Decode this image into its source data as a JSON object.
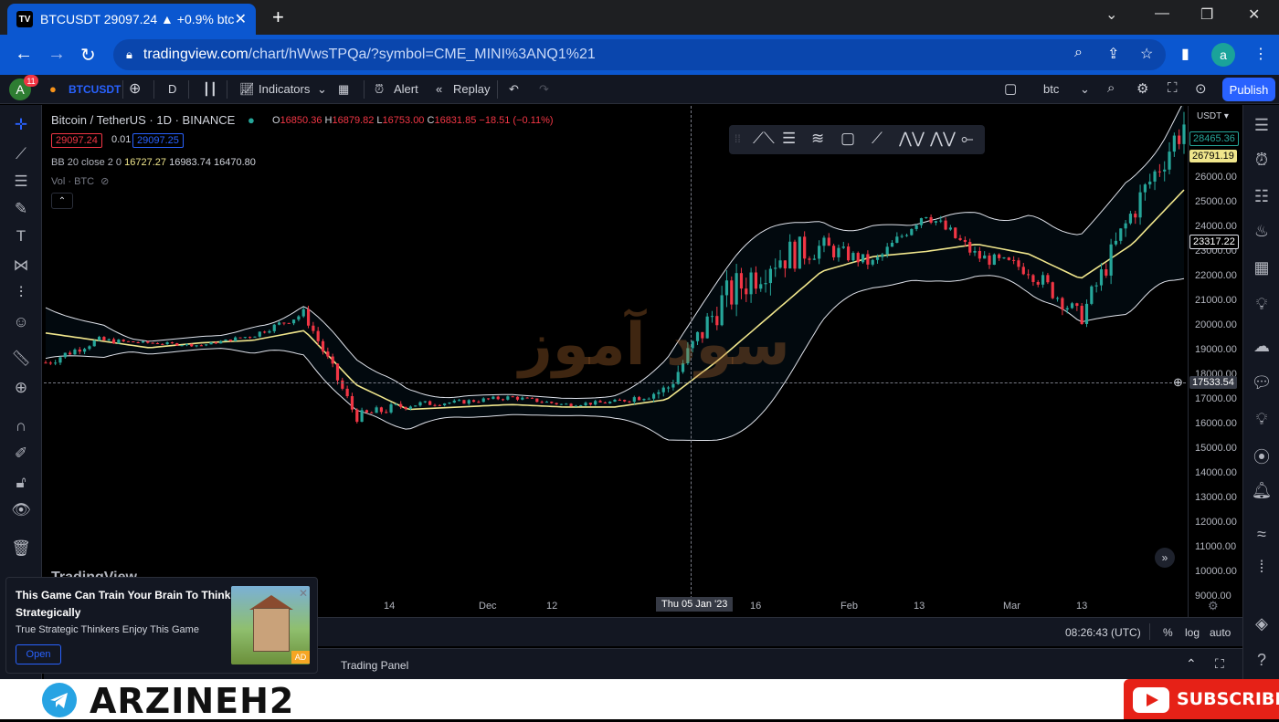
{
  "browser": {
    "tab_title": "BTCUSDT 29097.24 ▲ +0.9% btc",
    "tab_favicon": "TV",
    "url_host": "tradingview.com",
    "url_path": "/chart/hWwsTPQa/?symbol=CME_MINI%3ANQ1%21",
    "profile_initial": "a"
  },
  "toolbar": {
    "avatar_initial": "A",
    "notifications": "11",
    "symbol": "BTCUSDT",
    "interval": "D",
    "indicators_label": "Indicators",
    "alert_label": "Alert",
    "replay_label": "Replay",
    "layout_name": "btc",
    "publish_label": "Publish"
  },
  "legend": {
    "title": "Bitcoin / TetherUS · 1D · BINANCE",
    "o_label": "O",
    "o": "16850.36",
    "h_label": "H",
    "h": "16879.82",
    "l_label": "L",
    "l": "16753.00",
    "c_label": "C",
    "c": "16831.85",
    "change": "−18.51 (−0.11%)",
    "bid": "29097.24",
    "spread": "0.01",
    "ask": "29097.25",
    "bb_label": "BB 20 close 2 0",
    "bb_basis": "16727.27",
    "bb_upper": "16983.74",
    "bb_lower": "16470.80",
    "vol_label": "Vol · BTC"
  },
  "watermark": "سود آموز",
  "tv_logo": "TradingView",
  "x_axis": {
    "labels": [
      "14",
      "Dec",
      "12",
      "16",
      "Feb",
      "13",
      "Mar",
      "13"
    ],
    "crosshair_label": "Thu 05 Jan '23"
  },
  "price_scale": {
    "currency": "USDT",
    "labels": [
      "26000.00",
      "25000.00",
      "24000.00",
      "23000.00",
      "22000.00",
      "21000.00",
      "20000.00",
      "19000.00",
      "18000.00",
      "17000.00",
      "16000.00",
      "15000.00",
      "14000.00",
      "13000.00",
      "12000.00",
      "11000.00",
      "10000.00",
      "9000.00"
    ],
    "tag_upper": "28465.36",
    "tag_price": "26791.19",
    "tag_basis": "23317.22",
    "tag_cross": "17533.54"
  },
  "bottom": {
    "time": "08:26:43 (UTC)",
    "percent": "%",
    "log": "log",
    "auto": "auto",
    "trading_panel": "Trading Panel"
  },
  "ad": {
    "headline": "This Game Can Train Your Brain To Think Strategically",
    "body": "True Strategic Thinkers Enjoy This Game",
    "cta": "Open",
    "tag": "AD"
  },
  "footer": {
    "brand": "ARZINEH2",
    "subscribe": "SUBSCRIBE"
  },
  "colors": {
    "up": "#26a69a",
    "down": "#f23645",
    "basis": "#f0e68c",
    "band": "#e0e3eb",
    "accent": "#2962ff"
  },
  "chart_data": {
    "type": "candlestick",
    "instrument": "BTCUSDT",
    "interval": "1D",
    "indicator": "Bollinger Bands (20, close, 2)",
    "y_range": [
      9000,
      27500
    ],
    "x": [
      "14",
      "Dec",
      "12",
      "Thu 05 Jan '23",
      "16",
      "Feb",
      "13",
      "Mar",
      "13"
    ],
    "basis_approx": [
      19700,
      19400,
      19100,
      19300,
      19400,
      19800,
      17600,
      16600,
      16700,
      16800,
      16700,
      16700,
      17000,
      18600,
      20400,
      22200,
      22800,
      23000,
      23300,
      22900,
      21900,
      23300,
      25500
    ],
    "close_approx": [
      18500,
      19400,
      19300,
      19200,
      19600,
      20500,
      16300,
      16800,
      16900,
      17100,
      16800,
      16900,
      17400,
      20800,
      22700,
      23200,
      22500,
      24600,
      22800,
      22300,
      20300,
      24600,
      28200
    ]
  }
}
